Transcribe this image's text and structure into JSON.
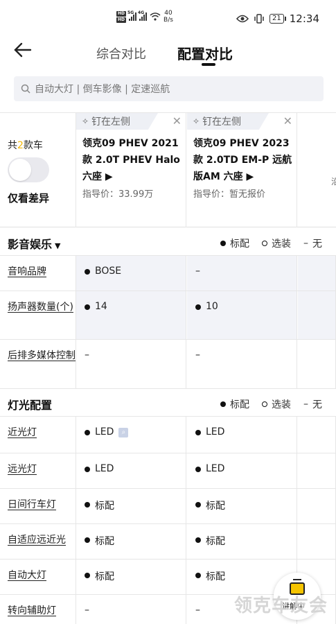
{
  "status": {
    "netspeed_value": "40",
    "netspeed_unit": "B/s",
    "battery": "21",
    "time": "12:34"
  },
  "header": {
    "tabs": [
      "综合对比",
      "配置对比"
    ],
    "active_tab": 1
  },
  "search": {
    "placeholder": "自动大灯 | 倒车影像 | 定速巡航"
  },
  "left_panel": {
    "count_prefix": "共",
    "count_num": "2",
    "count_suffix": "款车",
    "only_diff": "仅看差异"
  },
  "cars": [
    {
      "pin": "钉在左侧",
      "name": "领克09 PHEV 2021款 2.0T PHEV Halo 六座 ▶",
      "price": "指导价：33.99万"
    },
    {
      "pin": "钉在左侧",
      "name": "领克09 PHEV 2023款 2.0TD EM-P 远航版AM 六座 ▶",
      "price": "指导价：暂无报价"
    }
  ],
  "edge_text": "沿",
  "legend": {
    "standard": "标配",
    "optional": "选装",
    "none": "无"
  },
  "sections": [
    {
      "title": "影音娱乐",
      "rows": [
        {
          "label": "音响品牌",
          "v1": "BOSE",
          "v2": "–"
        },
        {
          "label": "扬声器数量(个)",
          "v1": "14",
          "v2": "10"
        },
        {
          "label": "后排多媒体控制",
          "v1": "–",
          "v2": "–"
        }
      ]
    },
    {
      "title": "灯光配置",
      "rows": [
        {
          "label": "近光灯",
          "v1": "LED",
          "v2": "LED"
        },
        {
          "label": "远光灯",
          "v1": "LED",
          "v2": "LED"
        },
        {
          "label": "日间行车灯",
          "v1": "标配",
          "v2": "标配"
        },
        {
          "label": "自适应远近光",
          "v1": "标配",
          "v2": "标配"
        },
        {
          "label": "自动大灯",
          "v1": "标配",
          "v2": "标配"
        },
        {
          "label": "转向辅助灯",
          "v1": "–",
          "v2": "–"
        }
      ]
    }
  ],
  "floating": {
    "label": "讲解中"
  },
  "watermark": "领克车友会"
}
